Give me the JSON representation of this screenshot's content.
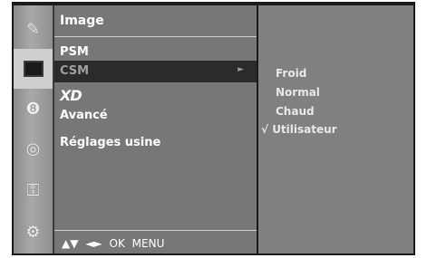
{
  "sidebar": {
    "icons": [
      {
        "name": "picture-icon",
        "glyph": "✎"
      },
      {
        "name": "screen-icon",
        "glyph": ""
      },
      {
        "name": "audio-icon",
        "glyph": "❽"
      },
      {
        "name": "time-icon",
        "glyph": "◎"
      },
      {
        "name": "setup-icon",
        "glyph": "⚿"
      },
      {
        "name": "option-icon",
        "glyph": "⚙"
      }
    ]
  },
  "main": {
    "title": "Image",
    "items": [
      {
        "label": "PSM"
      },
      {
        "label": "CSM",
        "arrow": "►"
      },
      {
        "label": "XD"
      },
      {
        "label": "Avancé"
      },
      {
        "label": "Réglages usine"
      }
    ],
    "footer": "▲▼ ◄► OK MENU"
  },
  "submenu": {
    "items": [
      {
        "check": "",
        "label": "Froid"
      },
      {
        "check": "",
        "label": "Normal"
      },
      {
        "check": "",
        "label": "Chaud"
      },
      {
        "check": "√",
        "label": "Utilisateur"
      }
    ]
  }
}
